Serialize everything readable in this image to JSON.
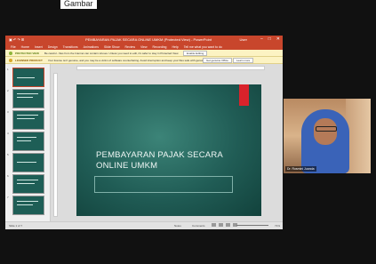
{
  "caption": "Gambar",
  "powerpoint": {
    "quick_access": "▣ ↶ ↷ ⊞",
    "document_title": "PEMBAYARAN PAJAK SECARA ONLINE UMKM (Protected View) - PowerPoint",
    "user": "User",
    "window_controls": [
      "–",
      "□",
      "✕"
    ],
    "menu_items": [
      "File",
      "Home",
      "Insert",
      "Design",
      "Transitions",
      "Animations",
      "Slide Show",
      "Review",
      "View",
      "Recording",
      "Help",
      "Tell me what you want to do"
    ],
    "warnings": [
      {
        "label": "PROTECTED VIEW",
        "message": "Be careful - files from the Internet can contain viruses. Unless you need to edit, it's safer to stay in Protected View.",
        "button": "Enable Editing"
      },
      {
        "label": "LICENSED PRODUCT",
        "message": "Your license isn't genuine, and you may be a victim of software counterfeiting. Avoid interruption and keep your files safe with genuine Office today.",
        "button": "Get genuine Office",
        "button2": "Learn more"
      }
    ],
    "thumbnails": [
      "1",
      "2",
      "3",
      "4",
      "5",
      "6",
      "7"
    ],
    "slide": {
      "title": "PEMBAYARAN PAJAK SECARA ONLINE UMKM"
    },
    "status": {
      "left": "Slide 1 of 7",
      "notes": "Notes",
      "comments": "Comments",
      "zoom": "71%"
    }
  },
  "video": {
    "participant_name": "Dr. Rosmini Juanda"
  },
  "colors": {
    "ppt_accent": "#c8462c",
    "slide_bg": "#205c55",
    "slide_accent": "#d9232b"
  }
}
